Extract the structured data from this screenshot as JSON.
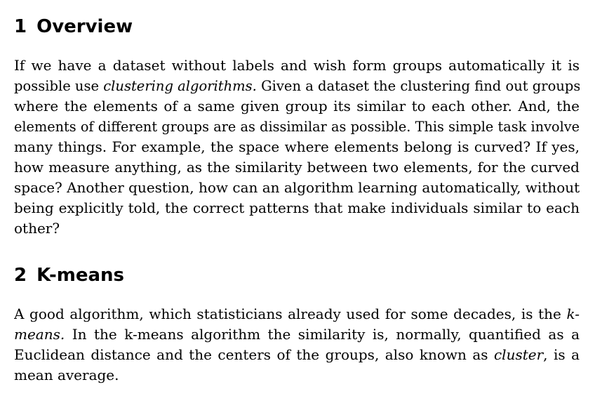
{
  "sections": [
    {
      "number": "1",
      "title": "Overview",
      "lines": [
        [
          {
            "t": "If we have a dataset without labels and wish form groups automatically it is"
          }
        ],
        [
          {
            "t": "possible use "
          },
          {
            "t": "clustering algorithms.",
            "i": true
          },
          {
            "t": " Given a dataset the clustering find out groups"
          }
        ],
        [
          {
            "t": "where the elements of a same given group its similar to each other.  And, the"
          }
        ],
        [
          {
            "t": "elements of different groups are as dissimilar as possible. This simple task involve"
          }
        ],
        [
          {
            "t": "many things.  For example, the space where elements belong is curved?  If yes,"
          }
        ],
        [
          {
            "t": "how measure anything, as the similarity between two elements, for the curved"
          }
        ],
        [
          {
            "t": "space? Another question, how can an algorithm learning automatically, without"
          }
        ],
        [
          {
            "t": "being explicitly told, the correct patterns that make individuals similar to each"
          }
        ],
        [
          {
            "t": "other?"
          }
        ]
      ]
    },
    {
      "number": "2",
      "title": "K-means",
      "lines": [
        [
          {
            "t": "A good algorithm, which statisticians already used for some decades, is the "
          },
          {
            "t": "k-",
            "i": true
          }
        ],
        [
          {
            "t": "means.",
            "i": true
          },
          {
            "t": "  In the k-means algorithm the similarity is, normally, quantified as a"
          }
        ],
        [
          {
            "t": "Euclidean distance and the centers of the groups, also known as "
          },
          {
            "t": "cluster",
            "i": true
          },
          {
            "t": ", is a"
          }
        ],
        [
          {
            "t": "mean average."
          }
        ]
      ]
    }
  ]
}
